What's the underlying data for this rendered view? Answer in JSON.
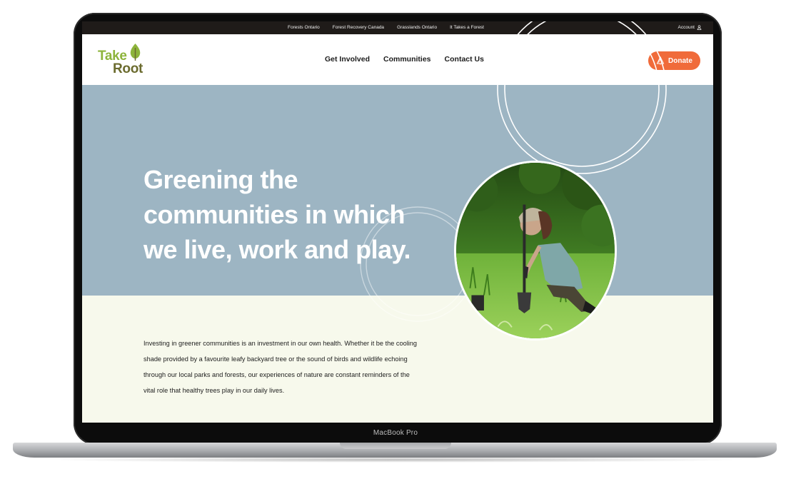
{
  "utility_nav": {
    "links": [
      "Forests Ontario",
      "Forest Recovery Canada",
      "Grasslands Ontario",
      "It Takes a Forest"
    ],
    "account_label": "Account"
  },
  "logo": {
    "line1": "Take",
    "line2": "Root"
  },
  "main_nav": {
    "items": [
      "Get Involved",
      "Communities",
      "Contact Us"
    ]
  },
  "donate": {
    "label": "Donate"
  },
  "hero": {
    "title_lines": [
      "Greening the",
      "communities in which",
      "we live, work and play."
    ]
  },
  "intro": {
    "text": "Investing in greener communities is an investment in our own health. Whether it be the cooling shade provided by a favourite leafy backyard tree or the sound of birds and wildlife echoing through our local parks and forests, our experiences of nature are constant reminders of the vital role that healthy trees play in our daily lives."
  },
  "device": {
    "label": "MacBook Pro"
  },
  "colors": {
    "accent": "#f06b3a",
    "hero_bg": "#9db5c3",
    "page_bg": "#f7f9ec",
    "topbar_bg": "#1f1b19",
    "logo_green": "#8db43b",
    "logo_olive": "#6b6b2e"
  },
  "icons": {
    "account": "user-icon",
    "donate": "tree-icon",
    "logo": "leaf-icon"
  }
}
